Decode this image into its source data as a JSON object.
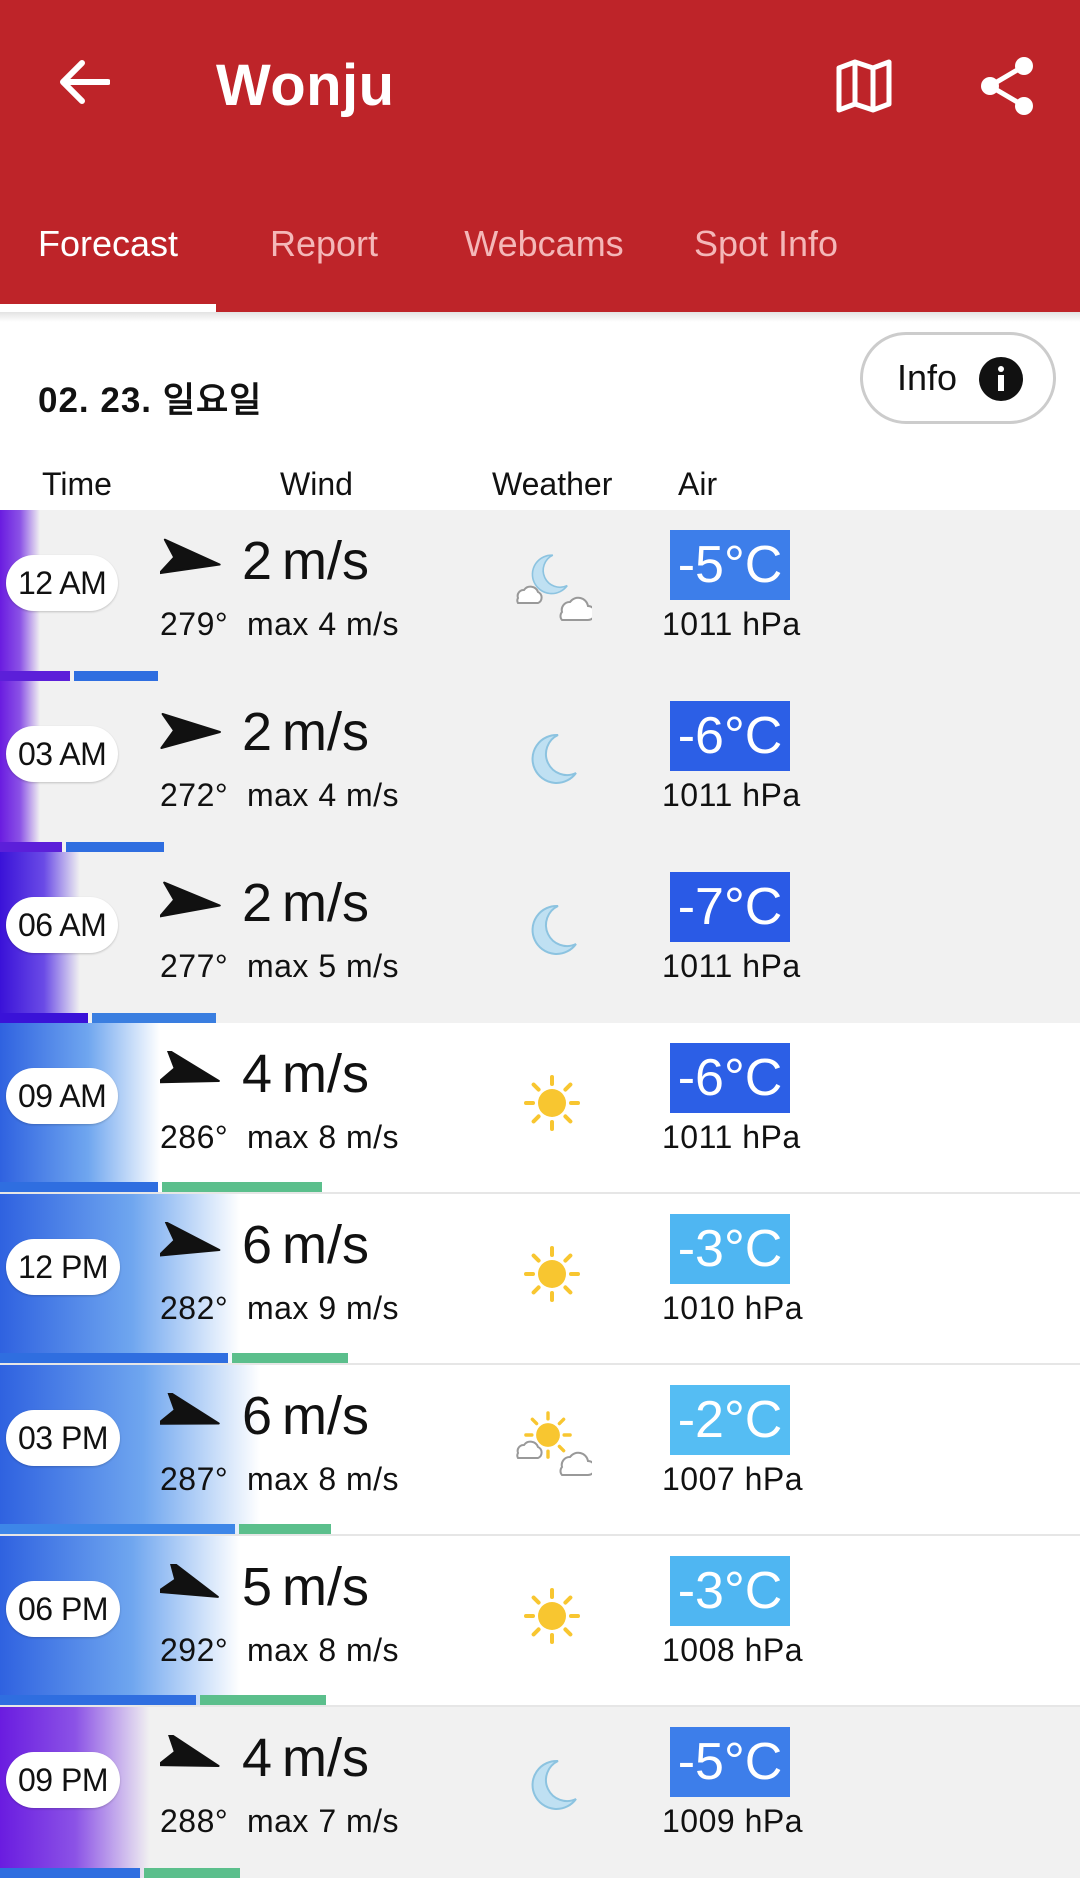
{
  "app": {
    "title": "Wonju",
    "icons": [
      "back-arrow-icon",
      "map-icon",
      "share-icon"
    ],
    "accent_color": "#be2429"
  },
  "tabs": [
    {
      "label": "Forecast",
      "active": true
    },
    {
      "label": "Report",
      "active": false
    },
    {
      "label": "Webcams",
      "active": false
    },
    {
      "label": "Spot Info",
      "active": false
    }
  ],
  "date_label": "02. 23. 일요일",
  "info_button": {
    "label": "Info",
    "icon": "info-icon"
  },
  "columns": {
    "time": "Time",
    "wind": "Wind",
    "weather": "Weather",
    "air": "Air"
  },
  "rows": [
    {
      "time": "12 AM",
      "speed": "2",
      "unit": "m/s",
      "dir_line": "279°  max 4 m/s",
      "direction_deg": 279,
      "weather": "moon-cloud",
      "temp": "-5°C",
      "temp_color": "#3d7eea",
      "pressure": "1011 hPa",
      "night": true,
      "bar1": "#5c1fd9",
      "bar2": "#2f6ee0"
    },
    {
      "time": "03 AM",
      "speed": "2",
      "unit": "m/s",
      "dir_line": "272°  max 4 m/s",
      "direction_deg": 272,
      "weather": "moon",
      "temp": "-6°C",
      "temp_color": "#2c5fe6",
      "pressure": "1011 hPa",
      "night": true,
      "bar1": "#5c1fd9",
      "bar2": "#2f6ee0"
    },
    {
      "time": "06 AM",
      "speed": "2",
      "unit": "m/s",
      "dir_line": "277°  max 5 m/s",
      "direction_deg": 277,
      "weather": "moon",
      "temp": "-7°C",
      "temp_color": "#2a5ae6",
      "pressure": "1011 hPa",
      "night": true,
      "bar1": "#3a12d8",
      "bar2": "#3a7ee0"
    },
    {
      "time": "09 AM",
      "speed": "4",
      "unit": "m/s",
      "dir_line": "286°  max 8 m/s",
      "direction_deg": 286,
      "weather": "sun",
      "temp": "-6°C",
      "temp_color": "#2c5fe6",
      "pressure": "1011 hPa",
      "night": false,
      "bar1": "#2f6ee0",
      "bar2": "#5bbf8c"
    },
    {
      "time": "12 PM",
      "speed": "6",
      "unit": "m/s",
      "dir_line": "282°  max 9 m/s",
      "direction_deg": 282,
      "weather": "sun",
      "temp": "-3°C",
      "temp_color": "#4fb6f2",
      "pressure": "1010 hPa",
      "night": false,
      "bar1": "#2f6ee0",
      "bar2": "#5bbf8c"
    },
    {
      "time": "03 PM",
      "speed": "6",
      "unit": "m/s",
      "dir_line": "287°  max 8 m/s",
      "direction_deg": 287,
      "weather": "sun-cloud",
      "temp": "-2°C",
      "temp_color": "#55bdf3",
      "pressure": "1007 hPa",
      "night": false,
      "bar1": "#3d86e8",
      "bar2": "#5bbf8c"
    },
    {
      "time": "06 PM",
      "speed": "5",
      "unit": "m/s",
      "dir_line": "292°  max 8 m/s",
      "direction_deg": 292,
      "weather": "sun",
      "temp": "-3°C",
      "temp_color": "#4fb6f2",
      "pressure": "1008 hPa",
      "night": false,
      "bar1": "#2f6ee0",
      "bar2": "#5bbf8c"
    },
    {
      "time": "09 PM",
      "speed": "4",
      "unit": "m/s",
      "dir_line": "288°  max 7 m/s",
      "direction_deg": 288,
      "weather": "moon",
      "temp": "-5°C",
      "temp_color": "#3d7eea",
      "pressure": "1009 hPa",
      "night": true,
      "bar1": "#2f6ee0",
      "bar2": "#5bbf8c"
    }
  ]
}
